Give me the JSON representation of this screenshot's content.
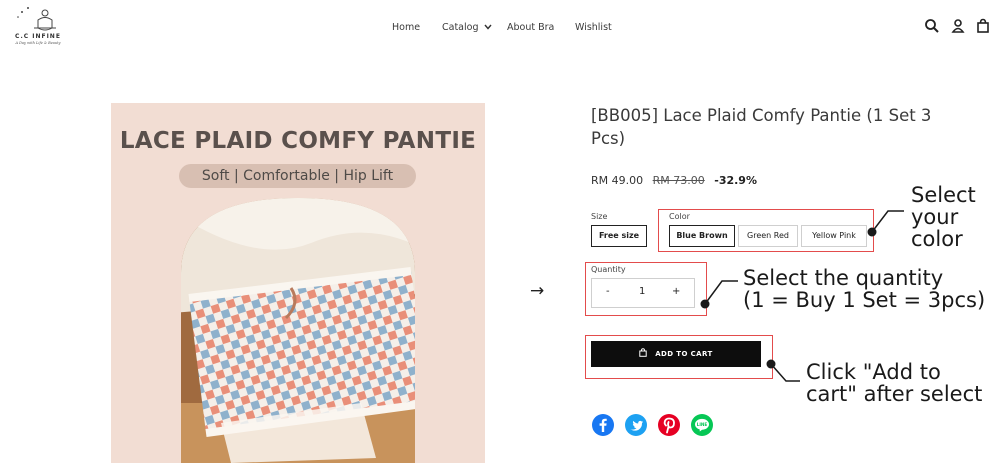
{
  "header": {
    "logo_text": "C.C INFINE",
    "logo_tagline": "A Day with Life & Beauty",
    "nav": [
      {
        "label": "Home"
      },
      {
        "label": "Catalog"
      },
      {
        "label": "About Bra"
      },
      {
        "label": "Wishlist"
      }
    ],
    "icons": [
      "search-icon",
      "user-icon",
      "cart-bag-icon"
    ]
  },
  "image": {
    "title": "LACE PLAID COMFY PANTIE",
    "subtitle": "Soft | Comfortable | Hip Lift"
  },
  "product": {
    "title": "[BB005] Lace Plaid Comfy Pantie (1 Set 3 Pcs)",
    "price": "RM 49.00",
    "compare_price": "RM 73.00",
    "discount": "-32.9%"
  },
  "options": {
    "size_label": "Size",
    "size_value": "Free size",
    "color_label": "Color",
    "colors": [
      "Blue Brown",
      "Green Red",
      "Yellow Pink"
    ],
    "selected_color": "Blue Brown"
  },
  "quantity": {
    "label": "Quantity",
    "minus": "-",
    "value": "1",
    "plus": "+"
  },
  "add_to_cart": "ADD TO CART",
  "annotations": {
    "arrow": "→",
    "select_color": [
      "Select",
      "your",
      "color"
    ],
    "select_quantity": [
      "Select the quantity",
      "(1 = Buy 1 Set = 3pcs)"
    ],
    "click_cart": [
      "Click \"Add to",
      "cart\" after select"
    ]
  },
  "social": [
    {
      "name": "facebook",
      "glyph": "f",
      "color": "#1877f2"
    },
    {
      "name": "twitter",
      "glyph": "t",
      "color": "#1da1f2"
    },
    {
      "name": "pinterest",
      "glyph": "p",
      "color": "#e60023"
    },
    {
      "name": "line",
      "glyph": "LINE",
      "color": "#06c755"
    }
  ],
  "colors": {
    "annotation_box": "#e34c4c",
    "button_dark": "#0d0d0d",
    "image_bg": "#f2ddd3"
  }
}
